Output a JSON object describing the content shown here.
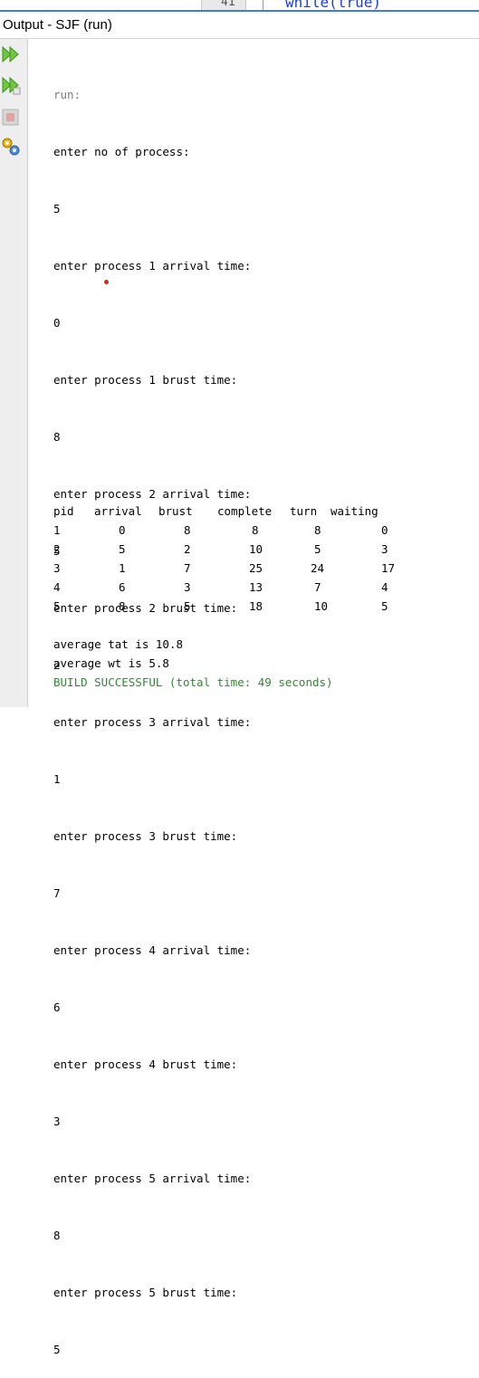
{
  "editor_peek": {
    "line_number": "41",
    "code": "while(true)"
  },
  "window": {
    "title": "Output - SJF (run)"
  },
  "toolbar": [
    {
      "icon": "rerun-icon"
    },
    {
      "icon": "rerun-with-options-icon"
    },
    {
      "icon": "stop-icon"
    },
    {
      "icon": "settings-icon"
    }
  ],
  "output": {
    "run_label": "run:",
    "lines": [
      "enter no of process:",
      "5",
      "enter process 1 arrival time:",
      "0",
      "enter process 1 brust time:",
      "8",
      "enter process 2 arrival time:",
      "5",
      "enter process 2 brust time:",
      "2",
      "enter process 3 arrival time:",
      "1",
      "enter process 3 brust time:",
      "7",
      "enter process 4 arrival time:",
      "6",
      "enter process 4 brust time:",
      "3",
      "enter process 5 arrival time:",
      "8",
      "enter process 5 brust time:",
      "5"
    ],
    "table": {
      "headers": [
        "pid",
        "arrival",
        "brust",
        "complete",
        "turn",
        "waiting"
      ],
      "rows": [
        [
          "1",
          "0",
          "8",
          "8",
          "8",
          "0"
        ],
        [
          "2",
          "5",
          "2",
          "10",
          "5",
          "3"
        ],
        [
          "3",
          "1",
          "7",
          "25",
          "24",
          "17"
        ],
        [
          "4",
          "6",
          "3",
          "13",
          "7",
          "4"
        ],
        [
          "5",
          "8",
          "5",
          "18",
          "10",
          "5"
        ]
      ]
    },
    "average_tat": "average tat is 10.8",
    "average_wt": "average wt is 5.8",
    "build_status": "BUILD SUCCESSFUL (total time: 49 seconds)"
  }
}
